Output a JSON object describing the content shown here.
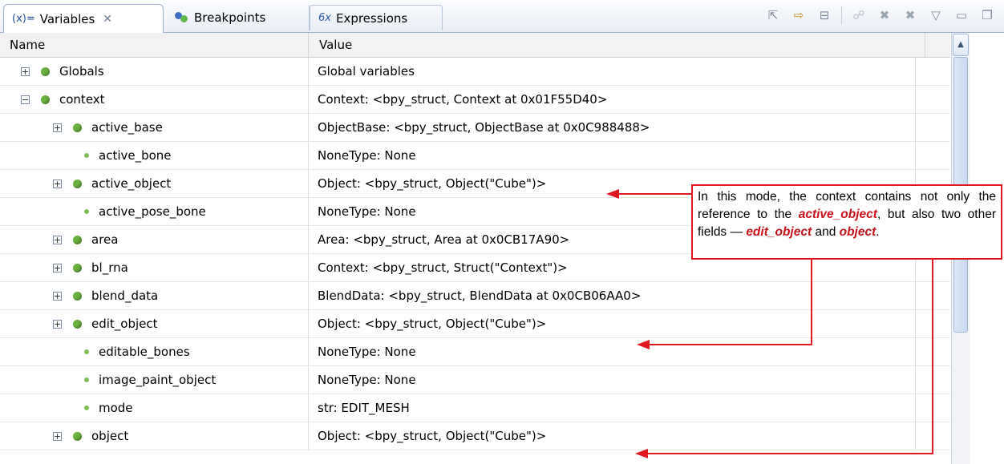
{
  "tabs": [
    {
      "label": "Variables",
      "prefix": "(x)=",
      "close": "✕"
    },
    {
      "label": "Breakpoints"
    },
    {
      "label": "Expressions",
      "glyph": "6x"
    }
  ],
  "toolbar_icons": [
    "show-type-icon",
    "collapse-step-icon",
    "collapse-all-icon",
    "remove-icon",
    "remove-all-icon",
    "view-menu-icon",
    "minimize-icon",
    "maximize-icon"
  ],
  "columns": {
    "name": "Name",
    "value": "Value"
  },
  "rows": [
    {
      "name": "Globals",
      "value": "Global variables"
    },
    {
      "name": "context",
      "value": "Context: <bpy_struct, Context at 0x01F55D40>"
    },
    {
      "name": "active_base",
      "value": "ObjectBase: <bpy_struct, ObjectBase at 0x0C988488>"
    },
    {
      "name": "active_bone",
      "value": "NoneType: None"
    },
    {
      "name": "active_object",
      "value": "Object: <bpy_struct, Object(\"Cube\")>"
    },
    {
      "name": "active_pose_bone",
      "value": "NoneType: None"
    },
    {
      "name": "area",
      "value": "Area: <bpy_struct, Area at 0x0CB17A90>"
    },
    {
      "name": "bl_rna",
      "value": "Context: <bpy_struct, Struct(\"Context\")>"
    },
    {
      "name": "blend_data",
      "value": "BlendData: <bpy_struct, BlendData at 0x0CB06AA0>"
    },
    {
      "name": "edit_object",
      "value": "Object: <bpy_struct, Object(\"Cube\")>"
    },
    {
      "name": "editable_bones",
      "value": "NoneType: None"
    },
    {
      "name": "image_paint_object",
      "value": "NoneType: None"
    },
    {
      "name": "mode",
      "value": "str: EDIT_MESH"
    },
    {
      "name": "object",
      "value": "Object: <bpy_struct, Object(\"Cube\")>"
    }
  ],
  "annotation": {
    "t1": "In this mode, the context contains not only the reference to the ",
    "b1": "active_object",
    "t2": ", but also two other fields — ",
    "b2": "edit_object",
    "t3": " and ",
    "b3": "object",
    "t4": "."
  },
  "colors": {
    "accent_red": "#e0171f",
    "var_green": "#6ab23f"
  }
}
